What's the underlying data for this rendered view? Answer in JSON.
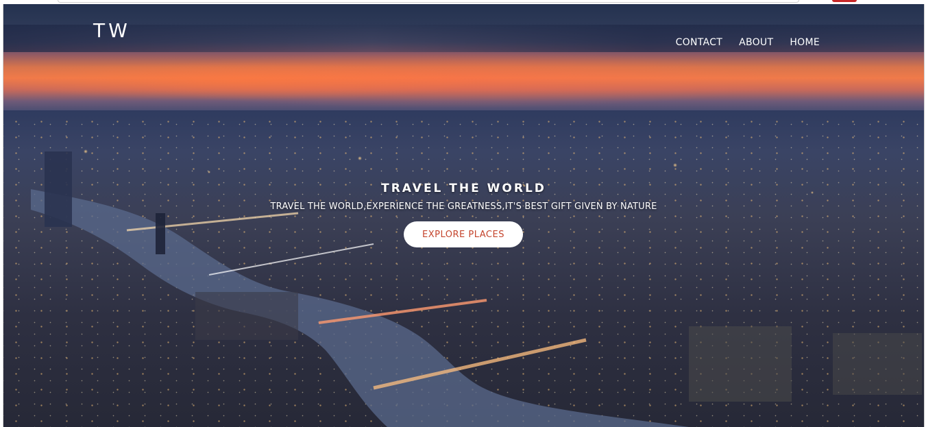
{
  "header": {
    "logo": "TW",
    "nav": [
      {
        "label": "CONTACT"
      },
      {
        "label": "ABOUT"
      },
      {
        "label": "HOME"
      }
    ]
  },
  "hero": {
    "title": "TRAVEL THE WORLD",
    "subtitle": "TRAVEL THE WORLD,EXPERIENCE THE GREATNESS,IT'S BEST GIFT GIVEN BY NATURE",
    "cta_label": "EXPLORE PLACES",
    "background": "aerial-city-dusk-image"
  },
  "colors": {
    "cta_text": "#c4442c",
    "cta_background": "#ffffff",
    "text": "#ffffff"
  }
}
